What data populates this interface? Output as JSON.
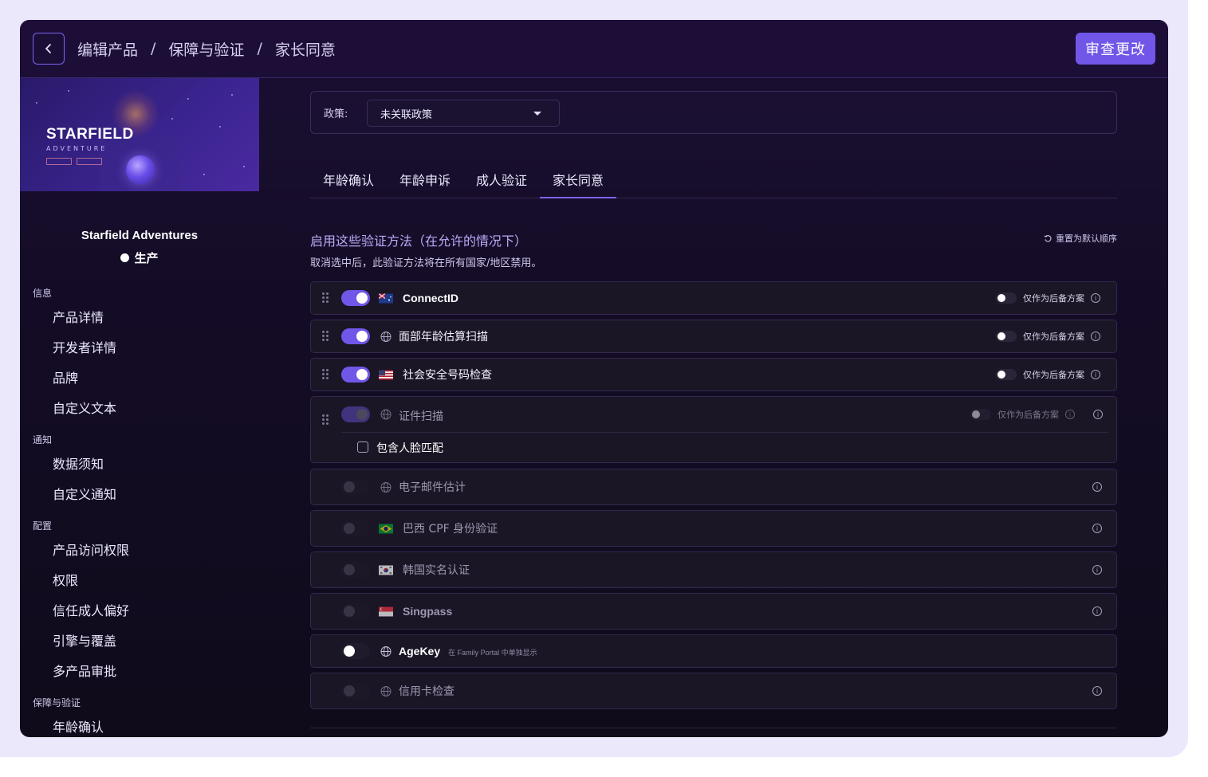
{
  "header": {
    "breadcrumb": [
      "编辑产品",
      "保障与验证",
      "家长同意"
    ],
    "review_button": "审查更改"
  },
  "hero": {
    "title": "STARFIELD",
    "subtitle": "ADVENTURE"
  },
  "product": {
    "name": "Starfield Adventures",
    "status": "生产"
  },
  "sidebar": {
    "sections": [
      {
        "title": "信息",
        "items": [
          "产品详情",
          "开发者详情",
          "品牌",
          "自定义文本"
        ]
      },
      {
        "title": "通知",
        "items": [
          "数据须知",
          "自定义通知"
        ]
      },
      {
        "title": "配置",
        "items": [
          "产品访问权限",
          "权限",
          "信任成人偏好",
          "引擎与覆盖",
          "多产品审批"
        ]
      },
      {
        "title": "保障与验证",
        "items": [
          "年龄确认"
        ]
      }
    ]
  },
  "policy": {
    "label": "政策:",
    "selected": "未关联政策"
  },
  "tabs": [
    "年龄确认",
    "年龄申诉",
    "成人验证",
    "家长同意"
  ],
  "active_tab": 3,
  "methods_section": {
    "title": "启用这些验证方法（在允许的情况下）",
    "subtitle": "取消选中后，此验证方法将在所有国家/地区禁用。",
    "reset_label": "重置为默认顺序",
    "fallback_label": "仅作为后备方案",
    "face_match_label": "包含人脸匹配",
    "agekey_note": "在 Family Portal 中单独显示"
  },
  "methods": [
    {
      "name": "ConnectID",
      "icon": "au-flag-icon",
      "enabled": true
    },
    {
      "name": "面部年龄估算扫描",
      "icon": "globe-icon",
      "enabled": true
    },
    {
      "name": "社会安全号码检查",
      "icon": "us-flag-icon",
      "enabled": true
    },
    {
      "name": "证件扫描",
      "icon": "globe-icon",
      "enabled": true
    },
    {
      "name": "电子邮件估计",
      "icon": "globe-icon",
      "enabled": false
    },
    {
      "name": "巴西 CPF 身份验证",
      "icon": "br-flag-icon",
      "enabled": false
    },
    {
      "name": "韩国实名认证",
      "icon": "kr-flag-icon",
      "enabled": false
    },
    {
      "name": "Singpass",
      "icon": "sg-flag-icon",
      "enabled": false
    },
    {
      "name": "AgeKey",
      "icon": "globe-icon",
      "enabled": false
    },
    {
      "name": "信用卡检查",
      "icon": "globe-icon",
      "enabled": false
    }
  ],
  "colors": {
    "accent": "#7256e8",
    "background": "#140c26",
    "topbar": "#1d0e38"
  }
}
